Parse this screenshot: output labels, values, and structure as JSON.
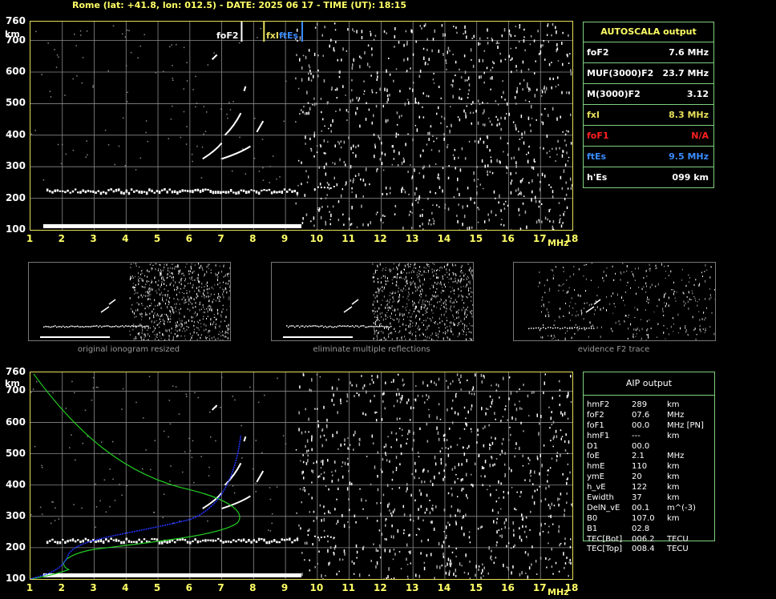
{
  "header": "Rome (lat: +41.8, lon: 012.5) - DATE: 2025 06 17 - TIME (UT): 18:15",
  "axes": {
    "y_ticks": [
      "760",
      "700",
      "600",
      "500",
      "400",
      "300",
      "200",
      "100"
    ],
    "y_unit": "km",
    "x_ticks": [
      "1",
      "2",
      "3",
      "4",
      "5",
      "6",
      "7",
      "8",
      "9",
      "10",
      "11",
      "12",
      "13",
      "14",
      "15",
      "16",
      "17",
      "18"
    ],
    "x_unit": "MHz"
  },
  "markers": {
    "foF2": "foF2",
    "fxI": "fxI",
    "ftEs": "ftEs"
  },
  "autoscala": {
    "title": "AUTOSCALA output",
    "rows": [
      {
        "key": "foF2",
        "value": "7.6 MHz",
        "color": "#ffffff"
      },
      {
        "key": "MUF(3000)F2",
        "value": "23.7 MHz",
        "color": "#ffffff"
      },
      {
        "key": "M(3000)F2",
        "value": "3.12",
        "color": "#ffffff"
      },
      {
        "key": "fxI",
        "value": "8.3 MHz",
        "color": "#e8e05a"
      },
      {
        "key": "foF1",
        "value": "N/A",
        "color": "#ff2020"
      },
      {
        "key": "ftEs",
        "value": "9.5 MHz",
        "color": "#3a8cff"
      },
      {
        "key": "h'Es",
        "value": "099     km",
        "color": "#ffffff"
      }
    ]
  },
  "thumbnails": [
    {
      "caption": "original ionogram resized"
    },
    {
      "caption": "eliminate multiple reflections"
    },
    {
      "caption": "evidence F2 trace"
    }
  ],
  "aip": {
    "title": "AIP output",
    "rows": [
      {
        "key": "hmF2",
        "value": "289",
        "unit": "km"
      },
      {
        "key": "foF2",
        "value": "07.6",
        "unit": "MHz"
      },
      {
        "key": "foF1",
        "value": "00.0",
        "unit": "MHz    [PN]"
      },
      {
        "key": "hmF1",
        "value": "---",
        "unit": "km"
      },
      {
        "key": "D1",
        "value": "00.0",
        "unit": ""
      },
      {
        "key": "foE",
        "value": "2.1",
        "unit": "MHz"
      },
      {
        "key": "hmE",
        "value": "110",
        "unit": "km"
      },
      {
        "key": "ymE",
        "value": "20",
        "unit": "km"
      },
      {
        "key": "h_vE",
        "value": "122",
        "unit": "km"
      },
      {
        "key": "Ewidth",
        "value": "37",
        "unit": "km"
      },
      {
        "key": "DelN_vE",
        "value": "00.1",
        "unit": "m^(-3)"
      },
      {
        "key": "B0",
        "value": "107.0",
        "unit": "km"
      },
      {
        "key": "B1",
        "value": "02.8",
        "unit": ""
      },
      {
        "key": "TEC[Bot]",
        "value": "006.2",
        "unit": "TECU"
      },
      {
        "key": "TEC[Top]",
        "value": "008.4",
        "unit": "TECU"
      }
    ]
  },
  "colors": {
    "axis": "#e8e05a",
    "grid": "#8a8a8a",
    "echo": "#ffffff",
    "profile": "#22cc22",
    "model": "#2233ff"
  }
}
